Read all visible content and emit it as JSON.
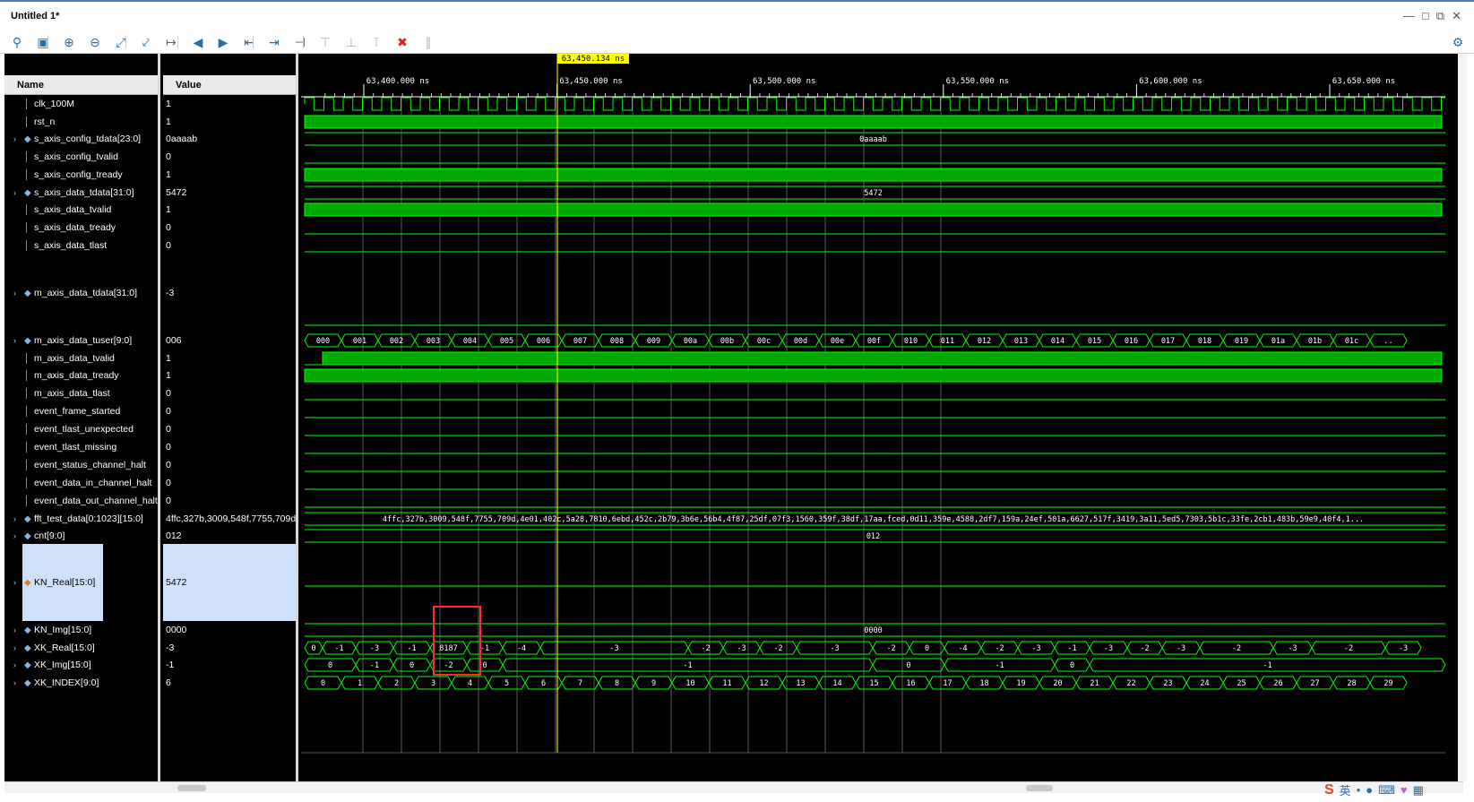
{
  "window": {
    "title": "Untitled 1*"
  },
  "toolbar": {
    "icons": [
      "search-icon",
      "save-icon",
      "zoom-in-icon",
      "zoom-out-icon",
      "zoom-fit-icon",
      "go-to-cursor-icon",
      "swap-cursor-icon",
      "go-to-time-zero-icon",
      "go-to-last-time-icon",
      "previous-transition-icon",
      "next-transition-icon",
      "add-marker-icon",
      "previous-marker-icon",
      "next-marker-icon",
      "swap-markers-icon",
      "delete-markers-icon",
      "snap-icon"
    ]
  },
  "headers": {
    "name": "Name",
    "value": "Value"
  },
  "cursor": {
    "label": "63,450.134 ns"
  },
  "timescale": {
    "labels": [
      "63,400.000 ns",
      "63,450.000 ns",
      "63,500.000 ns",
      "63,550.000 ns",
      "63,600.000 ns",
      "63,650.000 ns"
    ]
  },
  "signals": [
    {
      "name": "clk_100M",
      "value": "1",
      "icon": "bit",
      "expand": false
    },
    {
      "name": "rst_n",
      "value": "1",
      "icon": "bit",
      "expand": false
    },
    {
      "name": "s_axis_config_tdata[23:0]",
      "value": "0aaaab",
      "icon": "bus",
      "expand": true,
      "wave_text": "0aaaab"
    },
    {
      "name": "s_axis_config_tvalid",
      "value": "0",
      "icon": "bit",
      "expand": false
    },
    {
      "name": "s_axis_config_tready",
      "value": "1",
      "icon": "bit",
      "expand": false
    },
    {
      "name": "s_axis_data_tdata[31:0]",
      "value": "5472",
      "icon": "bus",
      "expand": true,
      "wave_text": "5472"
    },
    {
      "name": "s_axis_data_tvalid",
      "value": "1",
      "icon": "bit",
      "expand": false
    },
    {
      "name": "s_axis_data_tready",
      "value": "0",
      "icon": "bit",
      "expand": false
    },
    {
      "name": "s_axis_data_tlast",
      "value": "0",
      "icon": "bit",
      "expand": false
    },
    {
      "name": "m_axis_data_tdata[31:0]",
      "value": "-3",
      "icon": "bus",
      "expand": true
    },
    {
      "name": "m_axis_data_tuser[9:0]",
      "value": "006",
      "icon": "bus",
      "expand": true
    },
    {
      "name": "m_axis_data_tvalid",
      "value": "1",
      "icon": "bit",
      "expand": false
    },
    {
      "name": "m_axis_data_tready",
      "value": "1",
      "icon": "bit",
      "expand": false
    },
    {
      "name": "m_axis_data_tlast",
      "value": "0",
      "icon": "bit",
      "expand": false
    },
    {
      "name": "event_frame_started",
      "value": "0",
      "icon": "bit",
      "expand": false
    },
    {
      "name": "event_tlast_unexpected",
      "value": "0",
      "icon": "bit",
      "expand": false
    },
    {
      "name": "event_tlast_missing",
      "value": "0",
      "icon": "bit",
      "expand": false
    },
    {
      "name": "event_status_channel_halt",
      "value": "0",
      "icon": "bit",
      "expand": false
    },
    {
      "name": "event_data_in_channel_halt",
      "value": "0",
      "icon": "bit",
      "expand": false
    },
    {
      "name": "event_data_out_channel_halt",
      "value": "0",
      "icon": "bit",
      "expand": false
    },
    {
      "name": "fft_test_data[0:1023][15:0]",
      "value": "4ffc,327b,3009,548f,7755,709d,",
      "icon": "bus",
      "expand": true,
      "wave_text": "4ffc,327b,3009,548f,7755,709d,4e01,402c,5a28,7810,6ebd,452c,2b79,3b6e,56b4,4f87,25df,07f3,1560,359f,38df,17aa,fced,0d11,359e,4588,2df7,159a,24ef,501a,6627,517f,3419,3a11,5ed5,7303,5b1c,33fe,2cb1,483b,59e9,40f4,1..."
    },
    {
      "name": "cnt[9:0]",
      "value": "012",
      "icon": "bus",
      "expand": true,
      "wave_text": "012"
    },
    {
      "name": "KN_Real[15:0]",
      "value": "5472",
      "icon": "analog",
      "expand": true
    },
    {
      "name": "KN_Img[15:0]",
      "value": "0000",
      "icon": "bus",
      "expand": true,
      "wave_text": "0000"
    },
    {
      "name": "XK_Real[15:0]",
      "value": "-3",
      "icon": "bus",
      "expand": true
    },
    {
      "name": "XK_Img[15:0]",
      "value": "-1",
      "icon": "bus",
      "expand": true
    },
    {
      "name": "XK_INDEX[9:0]",
      "value": "6",
      "icon": "bus",
      "expand": true
    }
  ],
  "buses": {
    "tuser": [
      "000",
      "001",
      "002",
      "003",
      "004",
      "005",
      "006",
      "007",
      "008",
      "009",
      "00a",
      "00b",
      "00c",
      "00d",
      "00e",
      "00f",
      "010",
      "011",
      "012",
      "013",
      "014",
      "015",
      "016",
      "017",
      "018",
      "019",
      "01a",
      "01b",
      "01c",
      ".."
    ],
    "xk_real": [
      "0",
      "-1",
      "-3",
      "-1",
      "8187",
      "-1",
      "-4",
      "-3",
      "-2",
      "-3",
      "-2",
      "-3",
      "-2",
      "0",
      "-4",
      "-2",
      "-3",
      "-1",
      "-3",
      "-2",
      "-3",
      "-2",
      "-3",
      "-2",
      "-3"
    ],
    "xk_img": [
      "0",
      "-1",
      "0",
      "-2",
      "0",
      "-1",
      "0",
      "-1",
      "0",
      "-1"
    ],
    "xk_index": [
      "0",
      "1",
      "2",
      "3",
      "4",
      "5",
      "6",
      "7",
      "8",
      "9",
      "10",
      "11",
      "12",
      "13",
      "14",
      "15",
      "16",
      "17",
      "18",
      "19",
      "20",
      "21",
      "22",
      "23",
      "24",
      "25",
      "26",
      "27",
      "28",
      "29"
    ]
  },
  "colors": {
    "wave": "#00ff00",
    "cursor": "#ffff00",
    "highlight": "#ff2a2a",
    "select": "#cfe0fa"
  },
  "taskbar": {
    "ime": "英"
  }
}
